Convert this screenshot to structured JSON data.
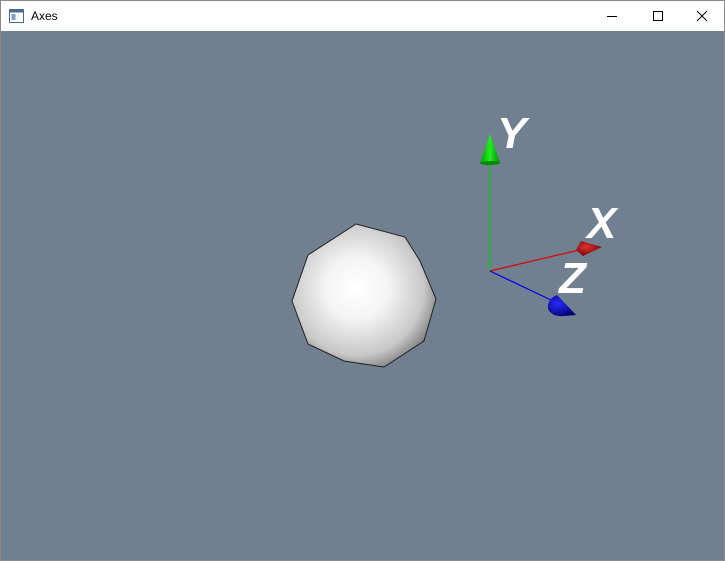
{
  "window": {
    "title": "Axes",
    "icons": {
      "app": "app-window-icon",
      "minimize": "minimize-icon",
      "maximize": "maximize-icon",
      "close": "close-icon"
    }
  },
  "scene": {
    "background_color": "#708090",
    "objects": [
      "sphere",
      "axes-actor"
    ],
    "axes": {
      "x": {
        "label": "X",
        "color": "#cc0000"
      },
      "y": {
        "label": "Y",
        "color": "#00cc00"
      },
      "z": {
        "label": "Z",
        "color": "#0000cc"
      }
    }
  }
}
